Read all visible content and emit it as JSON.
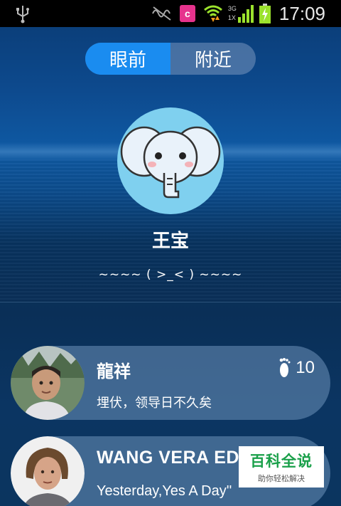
{
  "status_bar": {
    "time": "17:09",
    "network_label_top": "3G",
    "network_label_bottom": "1X",
    "app_icon_letter": "c",
    "icons": [
      "usb-icon",
      "silent-icon",
      "app-c-icon",
      "wifi-icon",
      "signal-icon",
      "battery-charging-icon"
    ]
  },
  "tabs": [
    {
      "label": "眼前",
      "active": true
    },
    {
      "label": "附近",
      "active": false
    }
  ],
  "profile": {
    "name": "王宝",
    "signature": "~~~~ ( >_< ) ~~~~",
    "avatar_icon": "elephant-avatar"
  },
  "contacts": [
    {
      "name": "龍祥",
      "message": "埋伏，领导日不久矣",
      "steps": "10",
      "step_icon": "footprint-icon"
    },
    {
      "name": "WANG VERA ED",
      "message": "Yesterday,Yes A Day''"
    }
  ],
  "watermark": {
    "main": "百科全说",
    "sub": "助你轻松解决"
  },
  "colors": {
    "tab_active": "#1a8cf0",
    "avatar_bg": "#7fd0ef",
    "watermark_green": "#1aa04a"
  }
}
